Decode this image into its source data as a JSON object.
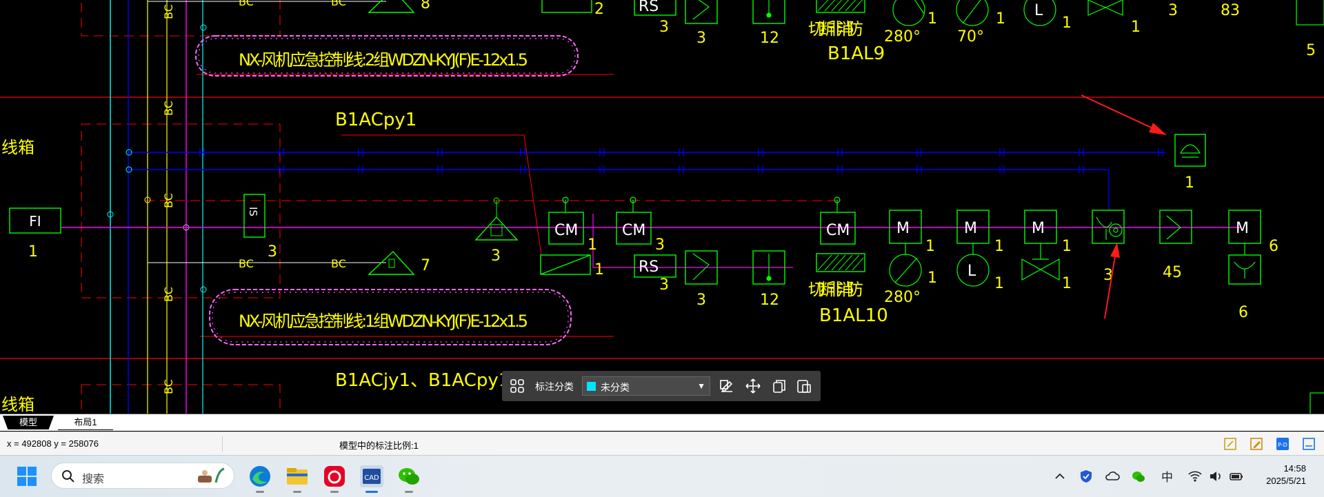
{
  "drawing": {
    "labels": {
      "bc": "BC",
      "box_left": "线箱",
      "fi": "FI",
      "fi_count": "1",
      "is": "IS",
      "is_count": "3",
      "speaker_count_top": "8",
      "speaker_count": "7",
      "fan_count": "3",
      "cm": "CM",
      "rs": "RS",
      "m": "M",
      "l": "L",
      "cloud_top": "NX-风机应急控制线:2组WDZN-KYJ(F)E-12x1.5",
      "cloud_bottom": "NX-风机应急控制线:1组WDZN-KYJ(F)E-12x1.5",
      "b1acpy1": "B1ACpy1",
      "b1acjy1": "B1ACjy1、B1ACpy1",
      "cutoff": "切断非消防",
      "b1al9": "B1AL9",
      "b1al10": "B1AL10",
      "deg280": "280°",
      "deg70": "70°",
      "n1": "1",
      "n2": "2",
      "n3": "3",
      "n5": "5",
      "n6": "6",
      "n12": "12",
      "n45": "45",
      "n83": "83"
    },
    "colors": {
      "yellow": "#ffff00",
      "green": "#00ff00",
      "blue": "#0000ff",
      "cyan": "#00ffff",
      "magenta": "#ff00ff",
      "red": "#ff0000",
      "white": "#ffffff",
      "cloud": "#ff66ff"
    }
  },
  "tabs": {
    "model": "模型",
    "layout1": "布局1"
  },
  "status": {
    "coords": "x = 492808 y = 258076",
    "scale": "模型中的标注比例:1"
  },
  "anno_toolbar": {
    "label": "标注分类",
    "selected": "未分类",
    "swatch_color": "#00e5ff"
  },
  "taskbar": {
    "search_placeholder": "搜索",
    "ime": "中",
    "time": "14:58",
    "date": "2025/5/21",
    "apps": [
      "edge-icon",
      "file-explorer-icon",
      "netease-music-icon",
      "cad-viewer-icon",
      "wechat-icon"
    ]
  }
}
